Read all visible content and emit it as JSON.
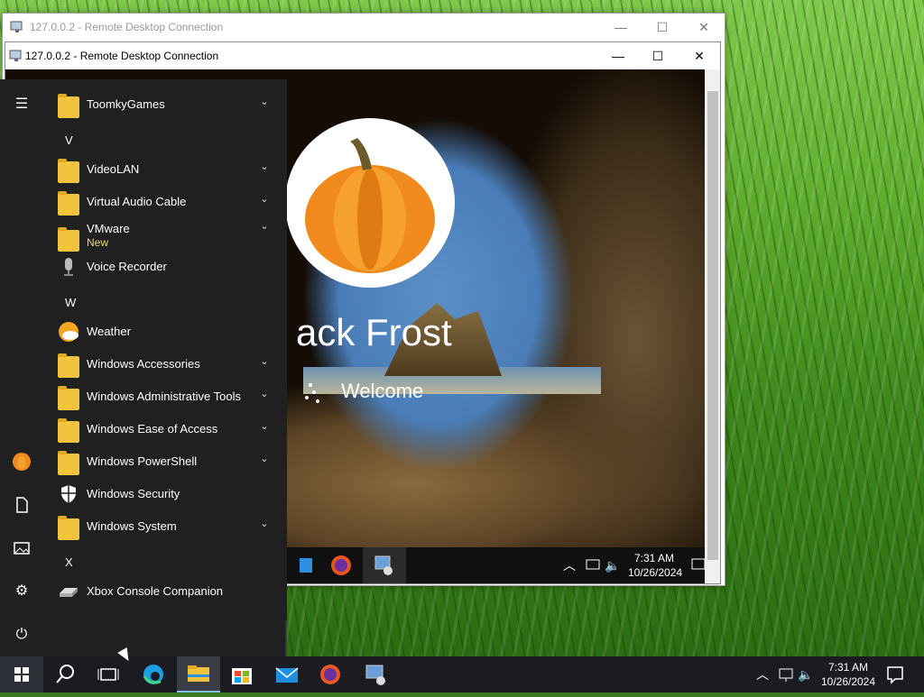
{
  "outer_window": {
    "title": "127.0.0.2 - Remote Desktop Connection"
  },
  "inner_window": {
    "title": "127.0.0.2 - Remote Desktop Connection"
  },
  "window_buttons": {
    "minimize": "—",
    "maximize": "☐",
    "close": "✕"
  },
  "lock_screen": {
    "user_name": "ack Frost",
    "welcome": "Welcome"
  },
  "remote_taskbar": {
    "time": "7:31 AM",
    "date": "10/26/2024"
  },
  "start_menu": {
    "items": [
      {
        "type": "item",
        "label": "ToomkyGames",
        "icon": "folder-icon",
        "expandable": true
      },
      {
        "type": "letter",
        "label": "V"
      },
      {
        "type": "item",
        "label": "VideoLAN",
        "icon": "folder-icon",
        "expandable": true
      },
      {
        "type": "item",
        "label": "Virtual Audio Cable",
        "icon": "folder-icon",
        "expandable": true
      },
      {
        "type": "item",
        "label": "VMware",
        "sublabel": "New",
        "icon": "folder-icon",
        "expandable": true
      },
      {
        "type": "item",
        "label": "Voice Recorder",
        "icon": "microphone-icon",
        "expandable": false
      },
      {
        "type": "letter",
        "label": "W"
      },
      {
        "type": "item",
        "label": "Weather",
        "icon": "weather-icon",
        "expandable": false
      },
      {
        "type": "item",
        "label": "Windows Accessories",
        "icon": "folder-icon",
        "expandable": true
      },
      {
        "type": "item",
        "label": "Windows Administrative Tools",
        "icon": "folder-icon",
        "expandable": true
      },
      {
        "type": "item",
        "label": "Windows Ease of Access",
        "icon": "folder-icon",
        "expandable": true
      },
      {
        "type": "item",
        "label": "Windows PowerShell",
        "icon": "folder-icon",
        "expandable": true
      },
      {
        "type": "item",
        "label": "Windows Security",
        "icon": "shield-icon",
        "expandable": false
      },
      {
        "type": "item",
        "label": "Windows System",
        "icon": "folder-icon",
        "expandable": true
      },
      {
        "type": "letter",
        "label": "X"
      },
      {
        "type": "item",
        "label": "Xbox Console Companion",
        "icon": "xbox-icon",
        "expandable": false
      }
    ],
    "rail": [
      "hamburger-icon",
      "user-avatar-icon",
      "documents-icon",
      "pictures-icon",
      "settings-icon",
      "power-icon"
    ]
  },
  "taskbar": {
    "time": "7:31 AM",
    "date": "10/26/2024",
    "icons": [
      "start-icon",
      "search-icon",
      "task-view-icon",
      "edge-icon",
      "file-explorer-icon",
      "store-icon",
      "mail-icon",
      "firefox-icon",
      "remote-desktop-icon"
    ]
  },
  "colors": {
    "start_menu_bg": "#202020",
    "taskbar_bg": "#1a1c22",
    "folder": "#f2c43d",
    "accent_underline": "#7fb8ff"
  }
}
